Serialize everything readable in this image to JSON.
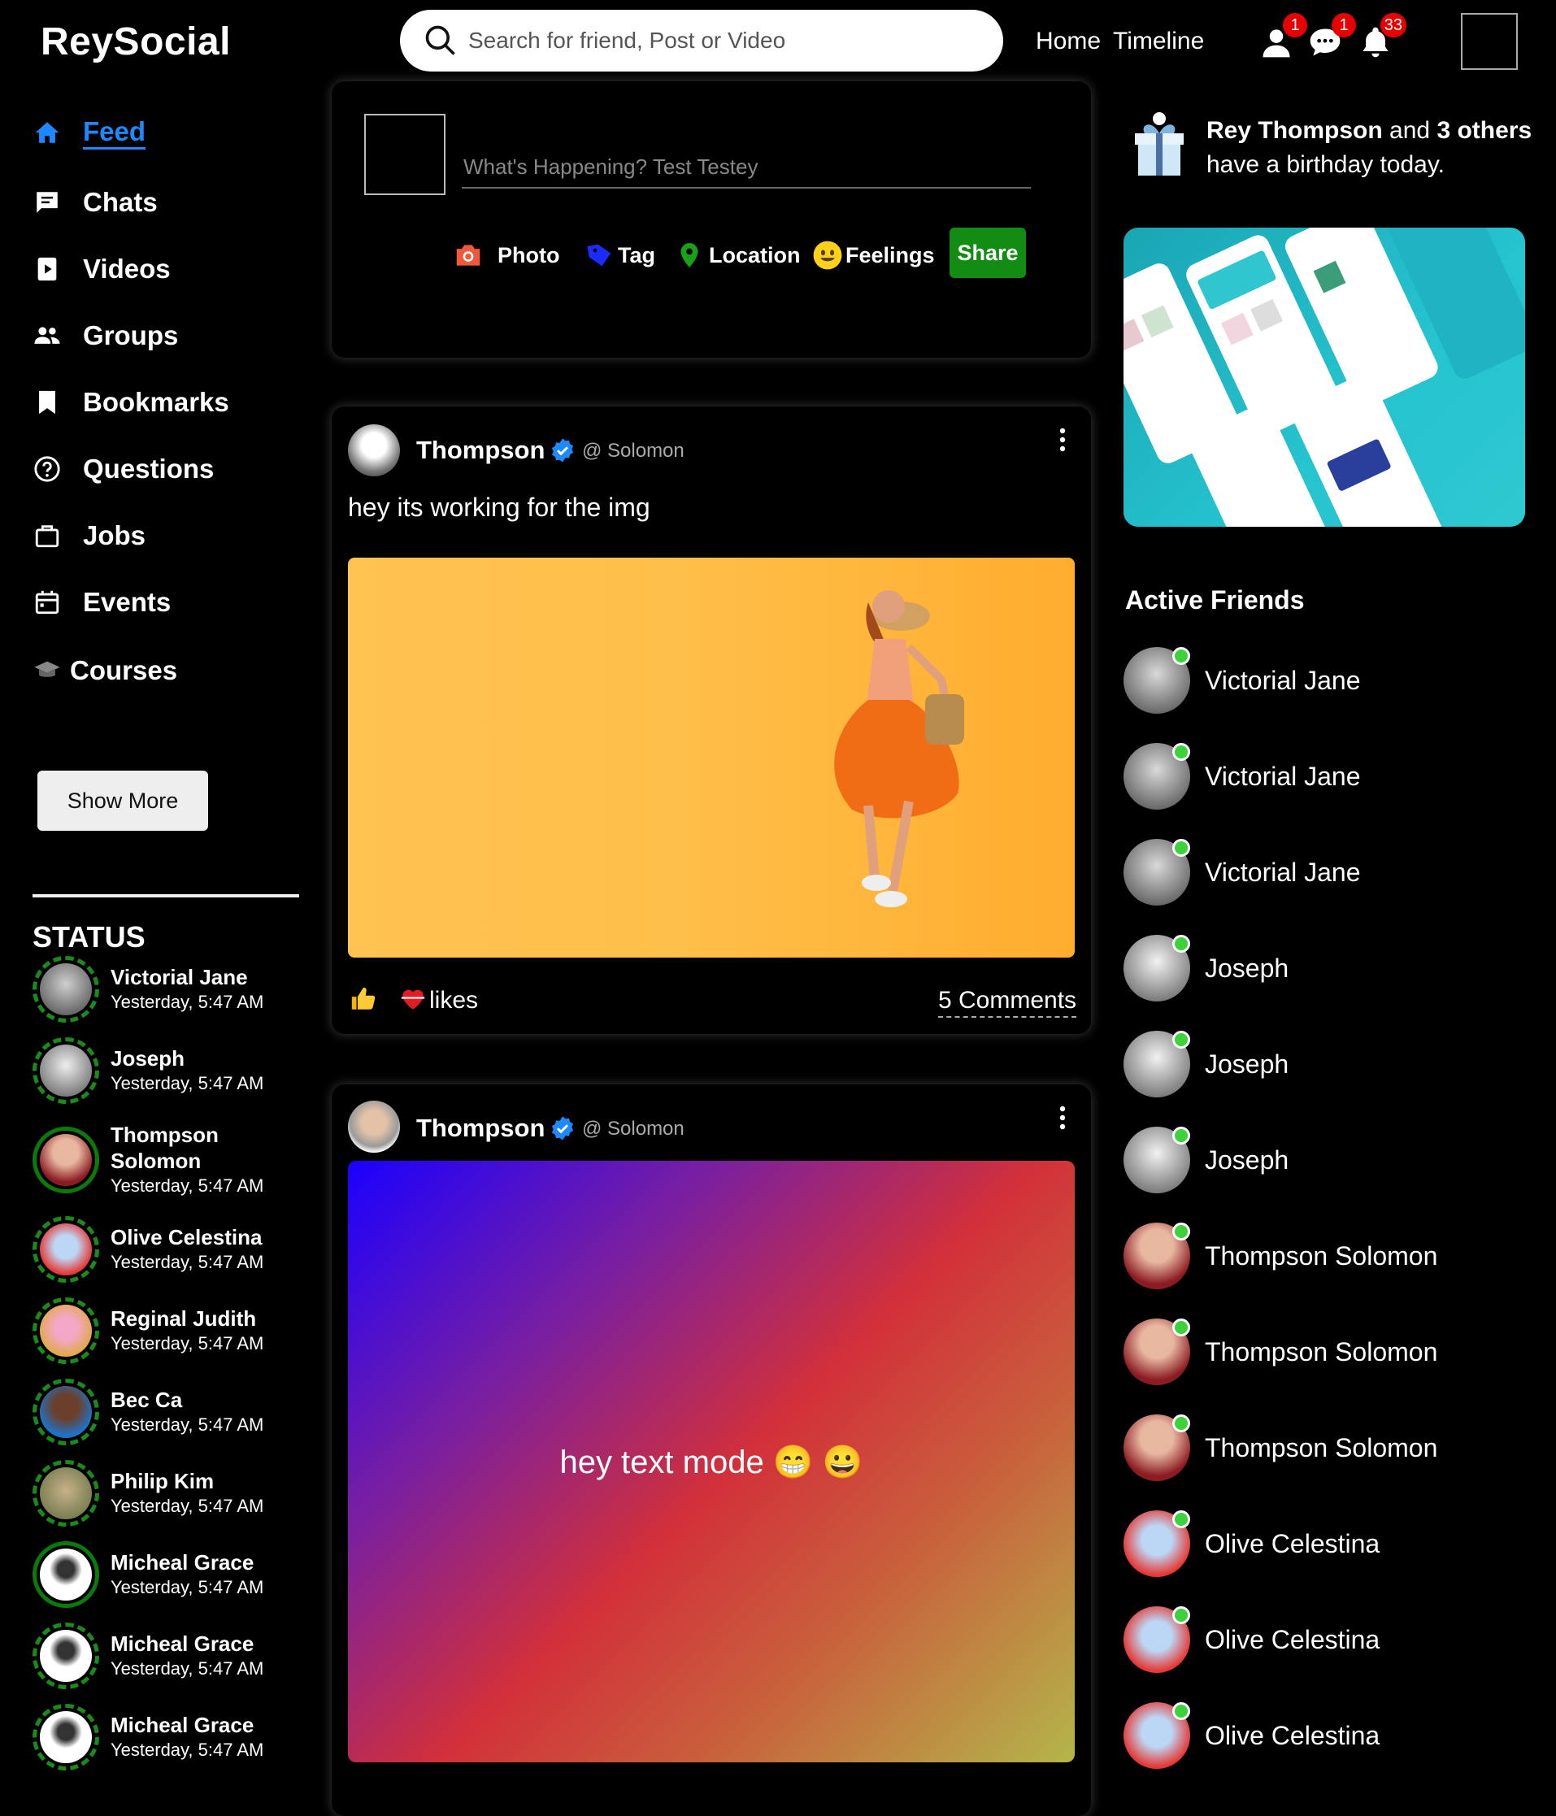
{
  "header": {
    "logo": "ReySocial",
    "search_placeholder": "Search for friend, Post or Video",
    "nav": [
      "Home",
      "Timeline"
    ],
    "badges": {
      "friends": "1",
      "messages": "1",
      "notifications": "33"
    }
  },
  "sidebar": {
    "items": [
      {
        "label": "Feed",
        "icon": "home-icon",
        "active": true
      },
      {
        "label": "Chats",
        "icon": "chat-icon"
      },
      {
        "label": "Videos",
        "icon": "video-icon"
      },
      {
        "label": "Groups",
        "icon": "groups-icon"
      },
      {
        "label": "Bookmarks",
        "icon": "bookmark-icon"
      },
      {
        "label": "Questions",
        "icon": "question-icon"
      },
      {
        "label": "Jobs",
        "icon": "briefcase-icon"
      },
      {
        "label": "Events",
        "icon": "calendar-icon"
      },
      {
        "label": "Courses",
        "icon": "graduation-cap-icon"
      }
    ],
    "show_more": "Show More",
    "status_title": "STATUS",
    "statuses": [
      {
        "name": "Victorial Jane",
        "time": "Yesterday, 5:47 AM"
      },
      {
        "name": "Joseph",
        "time": "Yesterday, 5:47 AM"
      },
      {
        "name": "Thompson Solomon",
        "time": "Yesterday, 5:47 AM"
      },
      {
        "name": "Olive Celestina",
        "time": "Yesterday, 5:47 AM"
      },
      {
        "name": "Reginal Judith",
        "time": "Yesterday, 5:47 AM"
      },
      {
        "name": "Bec Ca",
        "time": "Yesterday, 5:47 AM"
      },
      {
        "name": "Philip Kim",
        "time": "Yesterday, 5:47 AM"
      },
      {
        "name": "Micheal Grace",
        "time": "Yesterday, 5:47 AM"
      },
      {
        "name": "Micheal Grace",
        "time": "Yesterday, 5:47 AM"
      },
      {
        "name": "Micheal Grace",
        "time": "Yesterday, 5:47 AM"
      }
    ]
  },
  "composer": {
    "placeholder": "What's Happening? Test Testey",
    "actions": [
      "Photo",
      "Tag",
      "Location",
      "Feelings"
    ],
    "share": "Share"
  },
  "posts": [
    {
      "author": "Thompson",
      "handle": "@ Solomon",
      "text": "hey its working for the img",
      "likes": "likes",
      "comments": "5 Comments"
    },
    {
      "author": "Thompson",
      "handle": "@ Solomon",
      "text": "hey text mode 😁 😀"
    }
  ],
  "birthday": {
    "name": "Rey Thompson",
    "and": "and",
    "others": "3 others",
    "rest": "have a birthday today."
  },
  "active_friends": {
    "title": "Active Friends",
    "friends": [
      "Victorial Jane",
      "Victorial Jane",
      "Victorial Jane",
      "Joseph",
      "Joseph",
      "Joseph",
      "Thompson Solomon",
      "Thompson Solomon",
      "Thompson Solomon",
      "Olive Celestina",
      "Olive Celestina",
      "Olive Celestina"
    ]
  },
  "colors": {
    "accent": "#1e88ff",
    "share": "#128c12",
    "online": "#3bd23b",
    "badge": "#e60000"
  }
}
